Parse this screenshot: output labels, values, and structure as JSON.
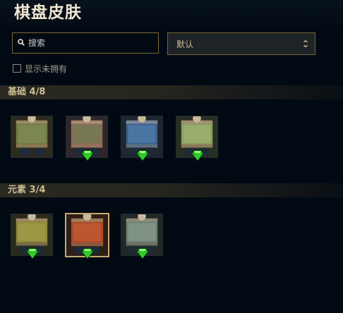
{
  "title": "棋盘皮肤",
  "search": {
    "placeholder": "搜索",
    "value": ""
  },
  "sort": {
    "selected": "默认"
  },
  "filter": {
    "show_unowned_label": "显示未拥有",
    "checked": false
  },
  "sections": [
    {
      "title": "基础 4/8",
      "tiles": [
        {
          "theme": "green-brown",
          "owned_gem": false,
          "selected": false
        },
        {
          "theme": "pink-green",
          "owned_gem": true,
          "selected": false
        },
        {
          "theme": "blue",
          "owned_gem": true,
          "selected": false
        },
        {
          "theme": "light-green",
          "owned_gem": true,
          "selected": false
        }
      ]
    },
    {
      "title": "元素 3/4",
      "tiles": [
        {
          "theme": "olive",
          "owned_gem": true,
          "selected": false
        },
        {
          "theme": "red",
          "owned_gem": true,
          "selected": true
        },
        {
          "theme": "grey-green",
          "owned_gem": true,
          "selected": false
        }
      ]
    }
  ],
  "colors": {
    "accent_gold": "#c8aa6e",
    "owned_gem": "#2fcf2a",
    "background": "#010a13"
  }
}
